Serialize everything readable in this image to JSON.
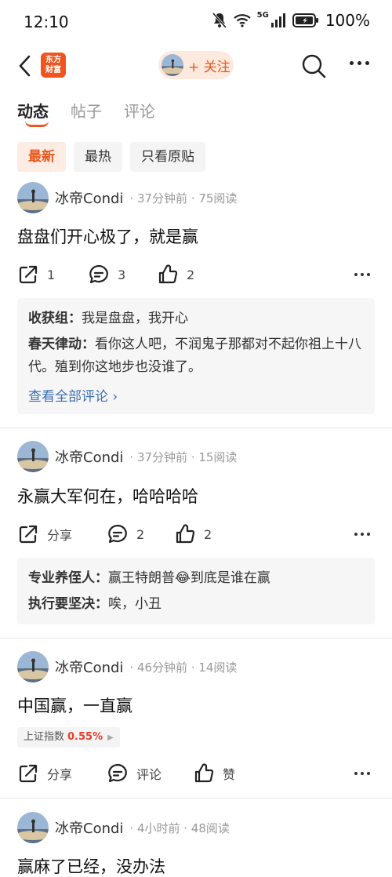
{
  "status_bar": {
    "time": "12:10",
    "network": "5G",
    "battery": "100%"
  },
  "nav": {
    "logo_text_line1": "东方",
    "logo_text_line2": "财富",
    "follow_label": "+ 关注"
  },
  "tabs": [
    {
      "label": "动态",
      "active": true
    },
    {
      "label": "帖子",
      "active": false
    },
    {
      "label": "评论",
      "active": false
    }
  ],
  "filters": [
    {
      "label": "最新",
      "active": true
    },
    {
      "label": "最热",
      "active": false
    },
    {
      "label": "只看原贴",
      "active": false
    }
  ],
  "posts": [
    {
      "author": "冰帝Condi",
      "meta": "· 37分钟前 · 75阅读",
      "title": "盘盘们开心极了，就是赢",
      "share": "1",
      "comment": "3",
      "like": "2",
      "comments": [
        {
          "name": "收获组：",
          "text": "我是盘盘，我开心"
        },
        {
          "name": "春天律动：",
          "text": "看你这人吧，不润鬼子那都对不起你祖上十八代。殖到你这地步也没谁了。"
        }
      ],
      "see_all": "查看全部评论 ›"
    },
    {
      "author": "冰帝Condi",
      "meta": "· 37分钟前 · 15阅读",
      "title": "永赢大军何在，哈哈哈哈",
      "share": "分享",
      "comment": "2",
      "like": "2",
      "comments": [
        {
          "name": "专业养侄人：",
          "text": "赢王特朗普😂到底是谁在赢"
        },
        {
          "name": "执行要坚决：",
          "text": "唉，小丑"
        }
      ]
    },
    {
      "author": "冰帝Condi",
      "meta": "· 46分钟前 · 14阅读",
      "title": "中国赢，一直赢",
      "stock_name": "上证指数",
      "stock_pct": "0.55%",
      "share": "分享",
      "comment": "评论",
      "like": "赞"
    },
    {
      "author": "冰帝Condi",
      "meta": "· 4小时前 · 48阅读",
      "title": "赢麻了已经，没办法"
    }
  ],
  "colors": {
    "accent": "#f0551e",
    "link": "#3b6fb3",
    "stock_up": "#e8402c"
  }
}
